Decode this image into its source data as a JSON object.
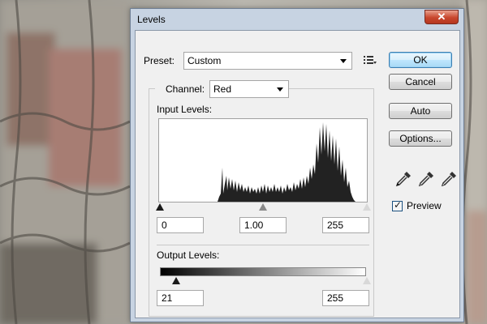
{
  "window": {
    "title": "Levels",
    "close_glyph": "✕"
  },
  "preset": {
    "label": "Preset:",
    "value": "Custom",
    "icon": "preset-options-icon"
  },
  "channel": {
    "label": "Channel:",
    "value": "Red"
  },
  "input_levels": {
    "label": "Input Levels:",
    "shadow": "0",
    "gamma": "1.00",
    "highlight": "255"
  },
  "output_levels": {
    "label": "Output Levels:",
    "shadow": "21",
    "highlight": "255"
  },
  "buttons": {
    "ok": "OK",
    "cancel": "Cancel",
    "auto": "Auto",
    "options": "Options..."
  },
  "eyedroppers": [
    "black-point-eyedropper-icon",
    "gray-point-eyedropper-icon",
    "white-point-eyedropper-icon"
  ],
  "preview": {
    "label": "Preview",
    "checked": true,
    "check_glyph": "✓"
  },
  "colors": {
    "dialog_frame": "#c7d3e2",
    "client_bg": "#f0f0f0",
    "default_button": "#bee6fd",
    "close_button": "#c8472d"
  }
}
